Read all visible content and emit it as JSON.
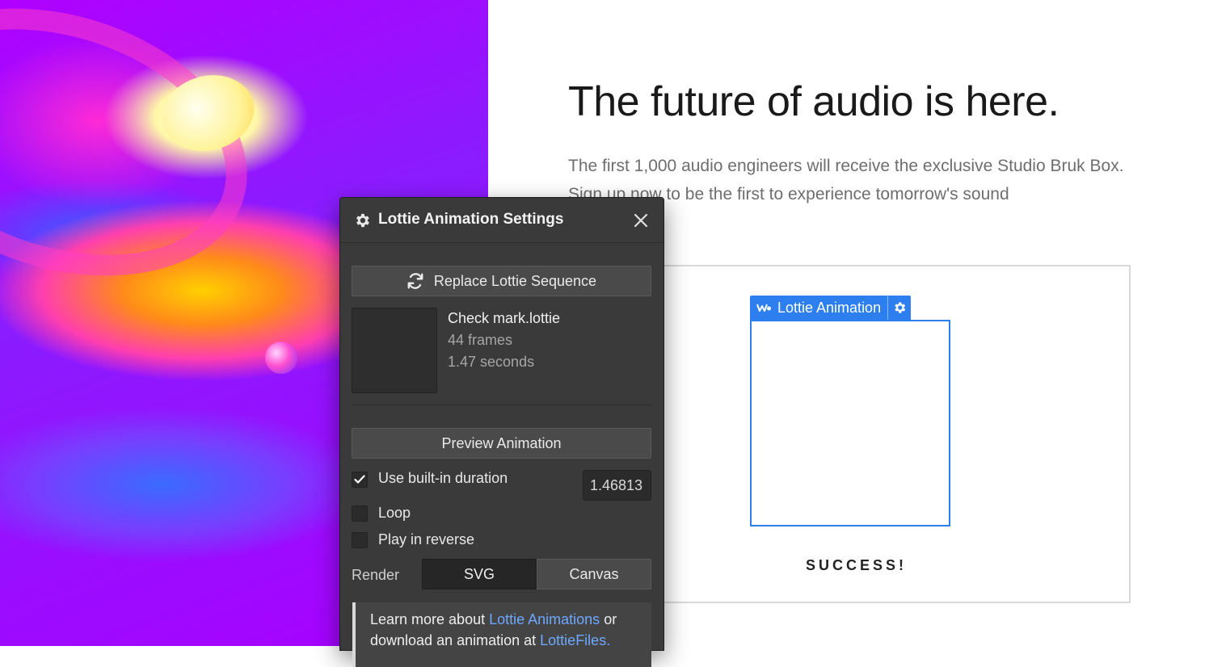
{
  "page": {
    "headline": "The future of audio is here.",
    "subtext": "The first 1,000 audio engineers will receive the exclusive Studio Bruk Box. Sign up now to be the first to experience tomorrow's sound",
    "success_text": "SUCCESS!"
  },
  "element_tag": {
    "label": "Lottie Animation",
    "icon": "webflow-logo-icon",
    "settings_icon": "gear-icon",
    "accent_color": "#2d7ff0"
  },
  "panel": {
    "title": "Lottie Animation Settings",
    "title_icon": "gear-icon",
    "close_icon": "close-icon",
    "replace_button": "Replace Lottie Sequence",
    "replace_icon": "refresh-icon",
    "file": {
      "name": "Check mark.lottie",
      "frames": "44 frames",
      "seconds": "1.47 seconds"
    },
    "preview_button": "Preview Animation",
    "use_builtin_duration": {
      "label": "Use built-in duration",
      "checked": true
    },
    "duration_value": "1.46813",
    "loop": {
      "label": "Loop",
      "checked": false
    },
    "reverse": {
      "label": "Play in reverse",
      "checked": false
    },
    "render": {
      "label": "Render",
      "options": [
        "SVG",
        "Canvas"
      ],
      "selected": "SVG"
    },
    "info": {
      "prefix": "Learn more about ",
      "link1": "Lottie Animations",
      "middle": " or download an animation at ",
      "link2": "LottieFiles."
    }
  }
}
